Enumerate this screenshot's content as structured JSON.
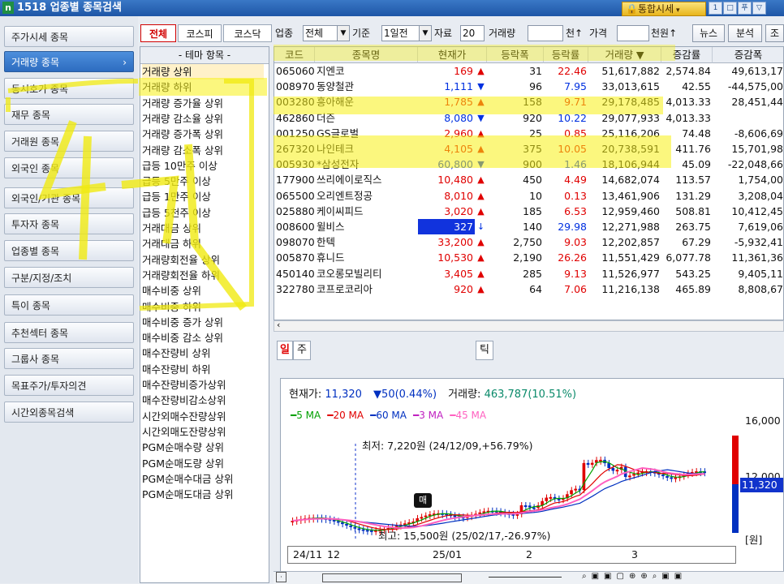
{
  "window": {
    "icon": "n",
    "title": "1518 업종별 종목검색",
    "integrated_button": "통합시세",
    "window_buttons": [
      "1",
      "□",
      "푸",
      "▽"
    ]
  },
  "nav": {
    "items": [
      {
        "label": "주가시세 종목",
        "active": false
      },
      {
        "label": "거래량 종목",
        "active": true,
        "arrow": "›"
      },
      {
        "label": "동시호가 종목",
        "active": false
      },
      {
        "label": "재무 종목",
        "active": false
      },
      {
        "label": "거래원 종목",
        "active": false
      },
      {
        "label": "외국인 종목",
        "active": false
      },
      {
        "label": "외국인/기관 종목",
        "active": false
      },
      {
        "label": "투자자 종목",
        "active": false
      },
      {
        "label": "업종별 종목",
        "active": false
      },
      {
        "label": "구분/지정/조치",
        "active": false
      },
      {
        "label": "특이 종목",
        "active": false
      },
      {
        "label": "추천섹터 종목",
        "active": false
      },
      {
        "label": "그룹사 종목",
        "active": false
      },
      {
        "label": "목표주가/투자의견",
        "active": false
      },
      {
        "label": "시간외종목검색",
        "active": false
      }
    ]
  },
  "toolbar": {
    "market_tabs": [
      "전체",
      "코스피",
      "코스닥"
    ],
    "sector_label": "업종",
    "sector_value": "전체",
    "basis_label": "기준",
    "basis_value": "1일전",
    "data_label": "자료",
    "data_value": "20",
    "volume_label": "거래량",
    "volume_value": "",
    "volume_unit": "천↑",
    "price_label": "가격",
    "price_value": "",
    "price_unit": "천원↑",
    "news_button": "뉴스",
    "analysis_button": "분석",
    "extra_button": "조"
  },
  "theme_list": {
    "header": "- 테마 항목 -",
    "items": [
      "거래량 상위",
      "거래량 하위",
      "거래량 증가율 상위",
      "거래량 감소율 상위",
      "거래량 증가폭 상위",
      "거래량 감소폭 상위",
      "급등 10만주 이상",
      "급등 5만주 이상",
      "급등 1만주 이상",
      "급등 5천주 이상",
      "거래대금 상위",
      "거래대금 하위",
      "거래량회전율 상위",
      "거래량회전율 하위",
      "매수비중 상위",
      "매수비중 하위",
      "매수비중 증가 상위",
      "매수비중 감소 상위",
      "매수잔량비 상위",
      "매수잔량비 하위",
      "매수잔량비증가상위",
      "매수잔량비감소상위",
      "시간외매수잔량상위",
      "시간외매도잔량상위",
      "PGM순매수량 상위",
      "PGM순매도량 상위",
      "PGM순매수대금 상위",
      "PGM순매도대금 상위"
    ],
    "selected_index": 0
  },
  "grid": {
    "columns": [
      "코드",
      "종목명",
      "현재가",
      "등락폭",
      "등락률",
      "거래량 ▼",
      "증감률",
      "증감폭"
    ],
    "rows": [
      {
        "code": "065060",
        "name": "지엔코",
        "price": "169",
        "dir": "up",
        "sign": "▲",
        "chg": "31",
        "rate": "22.46",
        "vol": "51,617,882",
        "incr": "2,574.84",
        "inc": "49,613,17"
      },
      {
        "code": "008970",
        "name": "동양철관",
        "price": "1,111",
        "dir": "dn",
        "sign": "▼",
        "chg": "96",
        "rate": "7.95",
        "vol": "33,013,615",
        "incr": "42.55",
        "inc": "-44,575,00"
      },
      {
        "code": "003280",
        "name": "흥아해운",
        "price": "1,785",
        "dir": "up",
        "sign": "▲",
        "chg": "158",
        "rate": "9.71",
        "vol": "29,178,485",
        "incr": "4,013.33",
        "inc": "28,451,44"
      },
      {
        "code": "462860",
        "name": "더즌",
        "price": "8,080",
        "dir": "dn",
        "sign": "▼",
        "chg": "920",
        "rate": "10.22",
        "vol": "29,077,933",
        "incr": "4,013.33",
        "inc": ""
      },
      {
        "code": "001250",
        "name": "GS글로벌",
        "price": "2,960",
        "dir": "up",
        "sign": "▲",
        "chg": "25",
        "rate": "0.85",
        "vol": "25,116,206",
        "incr": "74.48",
        "inc": "-8,606,69"
      },
      {
        "code": "267320",
        "name": "나인테크",
        "price": "4,105",
        "dir": "up",
        "sign": "▲",
        "chg": "375",
        "rate": "10.05",
        "vol": "20,738,591",
        "incr": "411.76",
        "inc": "15,701,98"
      },
      {
        "code": "005930",
        "name": "*삼성전자",
        "price": "60,800",
        "dir": "dn",
        "sign": "▼",
        "chg": "900",
        "rate": "1.46",
        "vol": "18,106,944",
        "incr": "45.09",
        "inc": "-22,048,66"
      },
      {
        "code": "177900",
        "name": "쓰리에이로직스",
        "price": "10,480",
        "dir": "up",
        "sign": "▲",
        "chg": "450",
        "rate": "4.49",
        "vol": "14,682,074",
        "incr": "113.57",
        "inc": "1,754,00"
      },
      {
        "code": "065500",
        "name": "오리엔트정공",
        "price": "8,010",
        "dir": "up",
        "sign": "▲",
        "chg": "10",
        "rate": "0.13",
        "vol": "13,461,906",
        "incr": "131.29",
        "inc": "3,208,04"
      },
      {
        "code": "025880",
        "name": "케이씨피드",
        "price": "3,020",
        "dir": "up",
        "sign": "▲",
        "chg": "185",
        "rate": "6.53",
        "vol": "12,959,460",
        "incr": "508.81",
        "inc": "10,412,45"
      },
      {
        "code": "008600",
        "name": "윌비스",
        "price": "327",
        "dir": "dn",
        "sign": "↓",
        "chg": "140",
        "rate": "29.98",
        "vol": "12,271,988",
        "incr": "263.75",
        "inc": "7,619,06",
        "limit": true
      },
      {
        "code": "098070",
        "name": "한텍",
        "price": "33,200",
        "dir": "up",
        "sign": "▲",
        "chg": "2,750",
        "rate": "9.03",
        "vol": "12,202,857",
        "incr": "67.29",
        "inc": "-5,932,41"
      },
      {
        "code": "005870",
        "name": "휴니드",
        "price": "10,530",
        "dir": "up",
        "sign": "▲",
        "chg": "2,190",
        "rate": "26.26",
        "vol": "11,551,429",
        "incr": "6,077.78",
        "inc": "11,361,36"
      },
      {
        "code": "450140",
        "name": "코오롱모빌리티",
        "price": "3,405",
        "dir": "up",
        "sign": "▲",
        "chg": "285",
        "rate": "9.13",
        "vol": "11,526,977",
        "incr": "543.25",
        "inc": "9,405,11"
      },
      {
        "code": "322780",
        "name": "코프로코리아",
        "price": "920",
        "dir": "up",
        "sign": "▲",
        "chg": "64",
        "rate": "7.06",
        "vol": "11,216,138",
        "incr": "465.89",
        "inc": "8,808,67"
      }
    ]
  },
  "bottom_tabs": {
    "day": "일",
    "week": "주",
    "tick": "틱"
  },
  "chart": {
    "info_price_label": "현재가:",
    "info_price": "11,320",
    "info_change": "▼50(0.44%)",
    "info_volume_label": "거래량:",
    "info_volume": "463,787(10.51%)",
    "ma_legend": [
      {
        "label": "━5 MA",
        "color": "#00a000"
      },
      {
        "label": "━20 MA",
        "color": "#e00000"
      },
      {
        "label": "━60 MA",
        "color": "#0030c0"
      },
      {
        "label": "━3 MA",
        "color": "#c020c0"
      },
      {
        "label": "━45 MA",
        "color": "#ff60c0"
      }
    ],
    "low_note": "최저: 7,220원 (24/12/09,+56.79%)",
    "high_note": "최고: 15,500원 (25/02/17,-26.97%)",
    "buy_marker": "매",
    "y_labels": [
      "16,000",
      "12,000"
    ],
    "current_price_box": "11,320",
    "unit": "[원]",
    "x_labels": [
      "24/11",
      "12",
      "25/01",
      "2",
      "3"
    ]
  },
  "annotation_text": "4개",
  "colors": {
    "up": "#e00000",
    "down": "#0030e0",
    "highlight": "#f8f014",
    "nav_active": "#2d6cc0"
  }
}
